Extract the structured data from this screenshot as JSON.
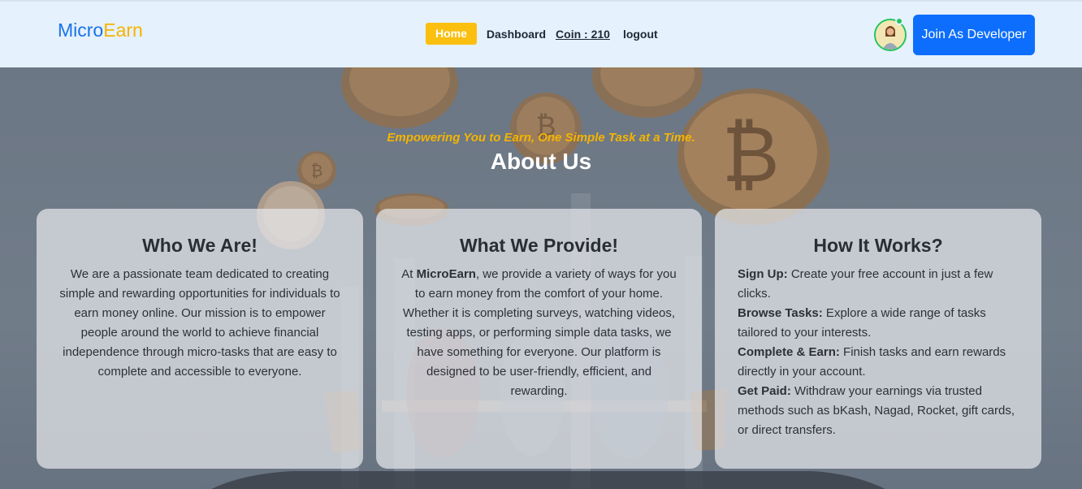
{
  "brand": {
    "part1": "Micro",
    "part2": "Earn"
  },
  "nav": {
    "home": "Home",
    "dashboard": "Dashboard",
    "coin": "Coin : 210",
    "logout": "logout",
    "join_button": "Join As Developer"
  },
  "hero": {
    "tagline": "Empowering You to Earn, One Simple Task at a Time.",
    "title": "About Us"
  },
  "cards": [
    {
      "title": "Who We Are!",
      "body": "We are a passionate team dedicated to creating simple and rewarding opportunities for individuals to earn money online. Our mission is to empower people around the world to achieve financial independence through micro-tasks that are easy to complete and accessible to everyone."
    },
    {
      "title": "What We Provide!",
      "body_prefix": "At ",
      "body_brand": "MicroEarn",
      "body_rest": ", we provide a variety of ways for you to earn money from the comfort of your home. Whether it is completing surveys, watching videos, testing apps, or performing simple data tasks, we have something for everyone. Our platform is designed to be user-friendly, efficient, and rewarding."
    },
    {
      "title": "How It Works?",
      "steps": [
        {
          "label": "Sign Up:",
          "text": " Create your free account in just a few clicks."
        },
        {
          "label": "Browse Tasks:",
          "text": " Explore a wide range of tasks tailored to your interests."
        },
        {
          "label": "Complete & Earn:",
          "text": " Finish tasks and earn rewards directly in your account."
        },
        {
          "label": "Get Paid:",
          "text": " Withdraw your earnings via trusted methods such as bKash, Nagad, Rocket, gift cards, or direct transfers."
        }
      ]
    }
  ],
  "colors": {
    "brand_blue": "#1a73e8",
    "brand_yellow": "#f5b400",
    "button_blue": "#0d6efd",
    "nav_bg": "#e5f1fc"
  }
}
